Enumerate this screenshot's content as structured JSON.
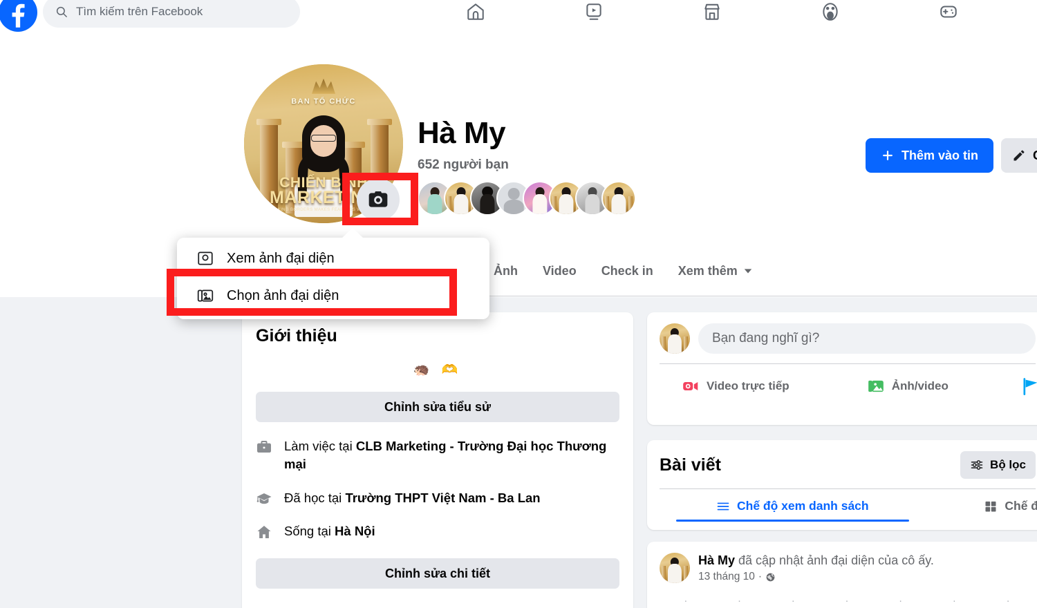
{
  "topbar": {
    "logo_icon": "facebook-logo",
    "search": {
      "icon": "search-icon",
      "placeholder": "Tìm kiếm trên Facebook",
      "value": ""
    },
    "nav_items": [
      {
        "name": "home",
        "icon": "home-icon"
      },
      {
        "name": "video",
        "icon": "video-icon"
      },
      {
        "name": "marketplace",
        "icon": "marketplace-icon"
      },
      {
        "name": "groups",
        "icon": "groups-icon"
      },
      {
        "name": "gaming",
        "icon": "gaming-icon"
      }
    ]
  },
  "profile": {
    "name": "Hà My",
    "friends_text": "652 người bạn",
    "avatar": {
      "banner_text": "BAN TỔ CHỨC",
      "title_line1": "CHIẾN BINH",
      "title_line2": "MARKETING",
      "subtitle": "BREAKING BORDERS MAKES FEARLESS WARRIORS"
    },
    "camera_button_icon": "camera-icon",
    "friend_avatar_count": 8,
    "story_button": {
      "label": "Thêm vào tin",
      "icon": "plus-icon"
    },
    "edit_button": {
      "label": "C",
      "icon": "pencil-icon"
    }
  },
  "tabs": [
    {
      "label": "Ảnh"
    },
    {
      "label": "Video"
    },
    {
      "label": "Check in"
    },
    {
      "label": "Xem thêm",
      "icon": "chevron-down-icon"
    }
  ],
  "intro": {
    "title": "Giới thiệu",
    "emojis": "🦔 🫶",
    "edit_bio_label": "Chỉnh sửa tiểu sử",
    "edit_details_label": "Chỉnh sửa chi tiết",
    "rows": [
      {
        "icon": "briefcase-icon",
        "prefix": "Làm việc tại ",
        "bold": "CLB Marketing - Trường Đại học Thương mại"
      },
      {
        "icon": "graduation-cap-icon",
        "prefix": "Đã học tại ",
        "bold": "Trường THPT Việt Nam - Ba Lan"
      },
      {
        "icon": "home-filled-icon",
        "prefix": "Sống tại ",
        "bold": "Hà Nội"
      }
    ]
  },
  "composer": {
    "placeholder": "Bạn đang nghĩ gì?",
    "actions": [
      {
        "label": "Video trực tiếp",
        "icon": "live-video-icon",
        "color": "#f3425f"
      },
      {
        "label": "Ảnh/video",
        "icon": "photo-video-icon",
        "color": "#45bd62"
      },
      {
        "label": "",
        "icon": "life-event-flag-icon",
        "color": "#00a5f4"
      }
    ]
  },
  "posts": {
    "title": "Bài viết",
    "filter_label": "Bộ lọc",
    "filter_icon": "filter-icon",
    "view_tabs": [
      {
        "label": "Chế độ xem danh sách",
        "icon": "list-icon",
        "active": true
      },
      {
        "label": "Chế đ",
        "icon": "grid-icon",
        "active": false
      }
    ],
    "entries": [
      {
        "author": "Hà My",
        "action": " đã cập nhật ảnh đại diện của cô ấy.",
        "date": "13 tháng 10",
        "separator": "·",
        "privacy_icon": "globe-icon"
      }
    ]
  },
  "menu": {
    "items": [
      {
        "label": "Xem ảnh đại diện",
        "icon": "view-photo-icon"
      },
      {
        "label": "Chọn ảnh đại diện",
        "icon": "choose-photo-icon"
      }
    ]
  },
  "colors": {
    "brand_blue": "#0866ff",
    "highlight_red": "#fb1d1d",
    "page_bg": "#f0f2f5",
    "gray_button": "#e4e6eb"
  }
}
